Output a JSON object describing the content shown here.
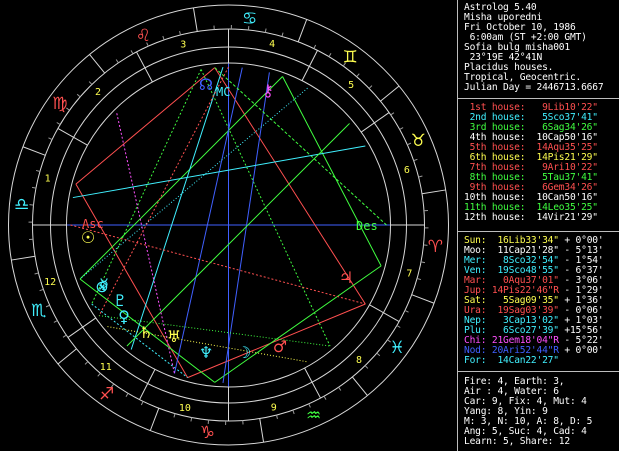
{
  "header": [
    "Astrolog 5.40",
    "Misha uporedni",
    "Fri October 10, 1986",
    " 6:00am (ST +2:00 GMT)",
    "Sofia bulg misha001",
    " 23°19E 42°41N",
    "Placidus houses.",
    "Tropical, Geocentric.",
    "Julian Day = 2446713.6667"
  ],
  "houses": [
    {
      "label": "1st house:",
      "value": "9Lib10'22\"",
      "color": "#ff5050"
    },
    {
      "label": "2nd house:",
      "value": "5Sco37'41\"",
      "color": "#40f0ff"
    },
    {
      "label": "3rd house:",
      "value": "6Sag34'26\"",
      "color": "#40ff40"
    },
    {
      "label": "4th house:",
      "value": "10Cap50'16\"",
      "color": "#ffffff"
    },
    {
      "label": "5th house:",
      "value": "14Aqu35'25\"",
      "color": "#ff5050"
    },
    {
      "label": "6th house:",
      "value": "14Pis21'29\"",
      "color": "#ffff50"
    },
    {
      "label": "7th house:",
      "value": "9Ari10'22\"",
      "color": "#ff5050"
    },
    {
      "label": "8th house:",
      "value": "5Tau37'41\"",
      "color": "#40ff40"
    },
    {
      "label": "9th house:",
      "value": "6Gem34'26\"",
      "color": "#ff5050"
    },
    {
      "label": "10th house:",
      "value": "10Can50'16\"",
      "color": "#ffffff"
    },
    {
      "label": "11th house:",
      "value": "14Leo35'25\"",
      "color": "#40ff40"
    },
    {
      "label": "12th house:",
      "value": "14Vir21'29\"",
      "color": "#ffffff"
    }
  ],
  "planets": [
    {
      "label": "Sun:",
      "pos": "16Lib33'34\"",
      "lat": "+ 0°00'",
      "color": "#ffff50"
    },
    {
      "label": "Moo:",
      "pos": "11Cap21'28\"",
      "lat": "- 5°13'",
      "color": "#ffffff"
    },
    {
      "label": "Mer:",
      "pos": "8Sco32'54\"",
      "lat": "- 1°54'",
      "color": "#40f0ff"
    },
    {
      "label": "Ven:",
      "pos": "19Sco48'55\"",
      "lat": "- 6°37'",
      "color": "#40f0ff"
    },
    {
      "label": "Mar:",
      "pos": "0Aqu37'01\"",
      "lat": "- 3°06'",
      "color": "#ff5050"
    },
    {
      "label": "Jup:",
      "pos": "14Pis22'46\"R",
      "lat": "- 1°29'",
      "color": "#ff5050"
    },
    {
      "label": "Sat:",
      "pos": "5Sag09'35\"",
      "lat": "+ 1°36'",
      "color": "#ffff50"
    },
    {
      "label": "Ura:",
      "pos": "19Sag03'39\"",
      "lat": "- 0°06'",
      "color": "#ff5050"
    },
    {
      "label": "Nep:",
      "pos": "3Cap13'02\"",
      "lat": "+ 1°03'",
      "color": "#40f0ff"
    },
    {
      "label": "Plu:",
      "pos": "6Sco27'39\"",
      "lat": "+15°56'",
      "color": "#40f0ff"
    },
    {
      "label": "Chi:",
      "pos": "21Gem18'04\"R",
      "lat": "- 5°22'",
      "color": "#ff50ff"
    },
    {
      "label": "Nod:",
      "pos": "20Ari52'44\"R",
      "lat": "+ 0°00'",
      "color": "#4060ff"
    },
    {
      "label": "For:",
      "pos": "14Can22'27\"",
      "lat": "",
      "color": "#40f0ff"
    }
  ],
  "stats": [
    "Fire: 4, Earth: 3,",
    "Air : 4, Water: 6",
    "Car: 9, Fix: 4, Mut: 4",
    "Yang: 8, Yin: 9",
    "M: 3, N: 10, A: 8, D: 5",
    "Ang: 5, Suc: 4, Cad: 4",
    "Learn: 5, Share: 12"
  ],
  "wheel": {
    "house_numbers": [
      "1",
      "2",
      "3",
      "4",
      "5",
      "6",
      "7",
      "8",
      "9",
      "10",
      "11",
      "12"
    ],
    "angles": {
      "asc": "Asc",
      "des": "Des",
      "mc": "MC",
      "ic": "IC"
    },
    "signs": [
      {
        "name": "libra-sign",
        "glyph": "♎",
        "color": "#40f0ff"
      },
      {
        "name": "virgo-sign",
        "glyph": "♍",
        "color": "#ff5050"
      },
      {
        "name": "leo-sign",
        "glyph": "♌",
        "color": "#ff5050"
      },
      {
        "name": "cancer-sign",
        "glyph": "♋",
        "color": "#40f0ff"
      },
      {
        "name": "gemini-sign",
        "glyph": "♊",
        "color": "#ffff50"
      },
      {
        "name": "taurus-sign",
        "glyph": "♉",
        "color": "#ffff50"
      },
      {
        "name": "aries-sign",
        "glyph": "♈",
        "color": "#ff5050"
      },
      {
        "name": "pisces-sign",
        "glyph": "♓",
        "color": "#40f0ff"
      },
      {
        "name": "aquarius-sign",
        "glyph": "♒",
        "color": "#40ff40"
      },
      {
        "name": "capricorn-sign",
        "glyph": "♑",
        "color": "#ff5050"
      },
      {
        "name": "sagittarius-sign",
        "glyph": "♐",
        "color": "#ff5050"
      },
      {
        "name": "scorpio-sign",
        "glyph": "♏",
        "color": "#40f0ff"
      }
    ],
    "planet_glyphs": [
      {
        "name": "sun-glyph",
        "glyph": "☉",
        "color": "#ffff50"
      },
      {
        "name": "moon-glyph",
        "glyph": "☽",
        "color": "#40f0ff"
      },
      {
        "name": "mercury-glyph",
        "glyph": "☿",
        "color": "#40f0ff"
      },
      {
        "name": "venus-glyph",
        "glyph": "♀",
        "color": "#40f0ff"
      },
      {
        "name": "mars-glyph",
        "glyph": "♂",
        "color": "#ff5050"
      },
      {
        "name": "jupiter-glyph",
        "glyph": "♃",
        "color": "#ff5050"
      },
      {
        "name": "saturn-glyph",
        "glyph": "♄",
        "color": "#ffff50"
      },
      {
        "name": "uranus-glyph",
        "glyph": "♅",
        "color": "#ffff50"
      },
      {
        "name": "neptune-glyph",
        "glyph": "♆",
        "color": "#40f0ff"
      },
      {
        "name": "pluto-glyph",
        "glyph": "♇",
        "color": "#40f0ff"
      },
      {
        "name": "chiron-glyph",
        "glyph": "⚷",
        "color": "#ff50ff"
      },
      {
        "name": "node-glyph",
        "glyph": "☊",
        "color": "#4060ff"
      },
      {
        "name": "fortune-glyph",
        "glyph": "⊗",
        "color": "#40f0ff"
      }
    ]
  }
}
